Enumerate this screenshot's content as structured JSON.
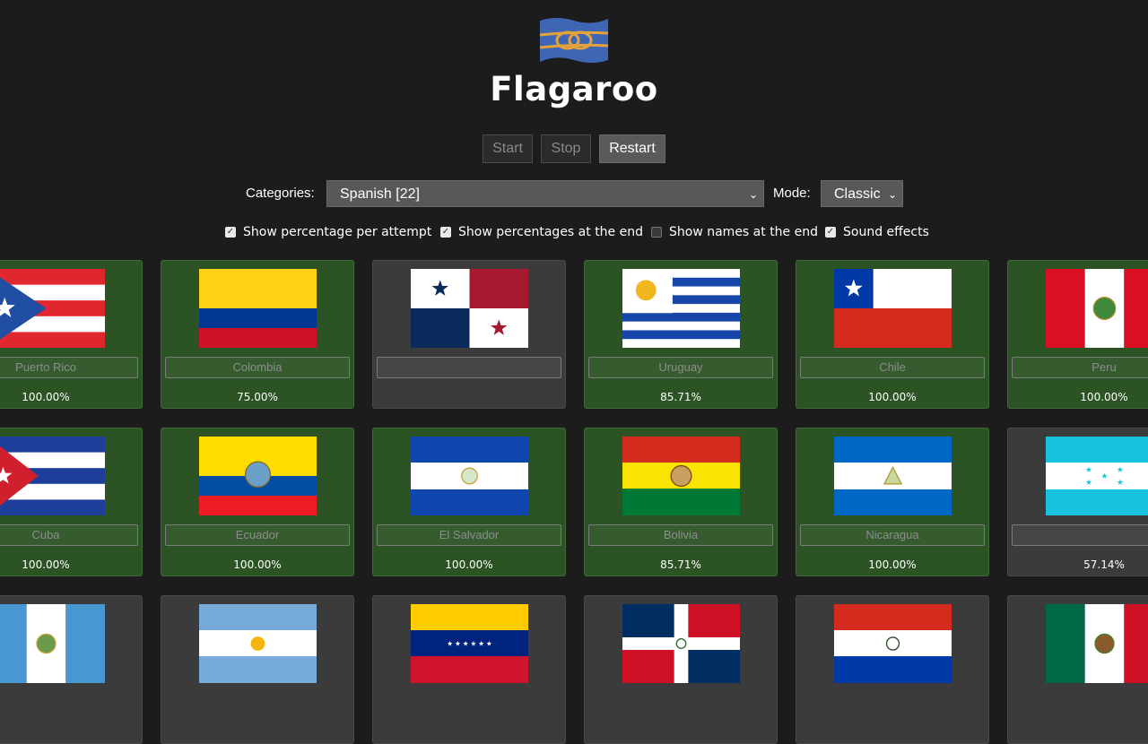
{
  "app": {
    "title": "Flagaroo",
    "logo_icon": "knot-flag-icon"
  },
  "controls": {
    "start": "Start",
    "stop": "Stop",
    "restart": "Restart"
  },
  "filters": {
    "categories_label": "Categories:",
    "categories_value": "Spanish [22]",
    "mode_label": "Mode:",
    "mode_value": "Classic"
  },
  "options": [
    {
      "label": "Show percentage per attempt",
      "checked": true
    },
    {
      "label": "Show percentages at the end",
      "checked": true
    },
    {
      "label": "Show names at the end",
      "checked": false
    },
    {
      "label": "Sound effects",
      "checked": true
    }
  ],
  "colors": {
    "correct_card": "#2b5324",
    "pending_card": "#3b3b3b",
    "background": "#1c1c1c"
  },
  "cards": [
    {
      "flag": "puerto-rico",
      "name": "Puerto Rico",
      "percent": "100.00%",
      "status": "correct"
    },
    {
      "flag": "colombia",
      "name": "Colombia",
      "percent": "75.00%",
      "status": "correct"
    },
    {
      "flag": "panama",
      "name": "",
      "percent": "",
      "status": "pending"
    },
    {
      "flag": "uruguay",
      "name": "Uruguay",
      "percent": "85.71%",
      "status": "correct"
    },
    {
      "flag": "chile",
      "name": "Chile",
      "percent": "100.00%",
      "status": "correct"
    },
    {
      "flag": "peru",
      "name": "Peru",
      "percent": "100.00%",
      "status": "correct"
    },
    {
      "flag": "cuba",
      "name": "Cuba",
      "percent": "100.00%",
      "status": "correct"
    },
    {
      "flag": "ecuador",
      "name": "Ecuador",
      "percent": "100.00%",
      "status": "correct"
    },
    {
      "flag": "el-salvador",
      "name": "El Salvador",
      "percent": "100.00%",
      "status": "correct"
    },
    {
      "flag": "bolivia",
      "name": "Bolivia",
      "percent": "85.71%",
      "status": "correct"
    },
    {
      "flag": "nicaragua",
      "name": "Nicaragua",
      "percent": "100.00%",
      "status": "correct"
    },
    {
      "flag": "honduras",
      "name": "",
      "percent": "57.14%",
      "status": "pending"
    },
    {
      "flag": "guatemala",
      "name": "",
      "percent": "",
      "status": "pending"
    },
    {
      "flag": "argentina",
      "name": "",
      "percent": "",
      "status": "pending"
    },
    {
      "flag": "venezuela",
      "name": "",
      "percent": "",
      "status": "pending"
    },
    {
      "flag": "dominican-republic",
      "name": "",
      "percent": "",
      "status": "pending"
    },
    {
      "flag": "paraguay",
      "name": "",
      "percent": "",
      "status": "pending"
    },
    {
      "flag": "mexico",
      "name": "",
      "percent": "",
      "status": "pending"
    }
  ]
}
